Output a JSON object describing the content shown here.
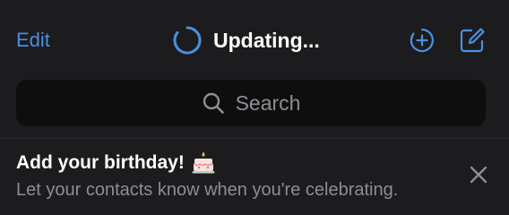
{
  "header": {
    "edit_label": "Edit",
    "title": "Updating...",
    "icons": {
      "spinner": "loading-spinner-icon",
      "new_story": "add-story-icon",
      "compose": "compose-icon"
    }
  },
  "search": {
    "placeholder": "Search",
    "icon": "search-icon"
  },
  "banner": {
    "title": "Add your birthday!",
    "icon": "birthday-cake-icon",
    "subtitle": "Let your contacts know when you're celebrating.",
    "close_icon": "close-icon"
  },
  "colors": {
    "background": "#1c1c1e",
    "accent": "#4a90e2",
    "search_background": "#0e0e0f",
    "secondary_text": "#8d8d93"
  }
}
